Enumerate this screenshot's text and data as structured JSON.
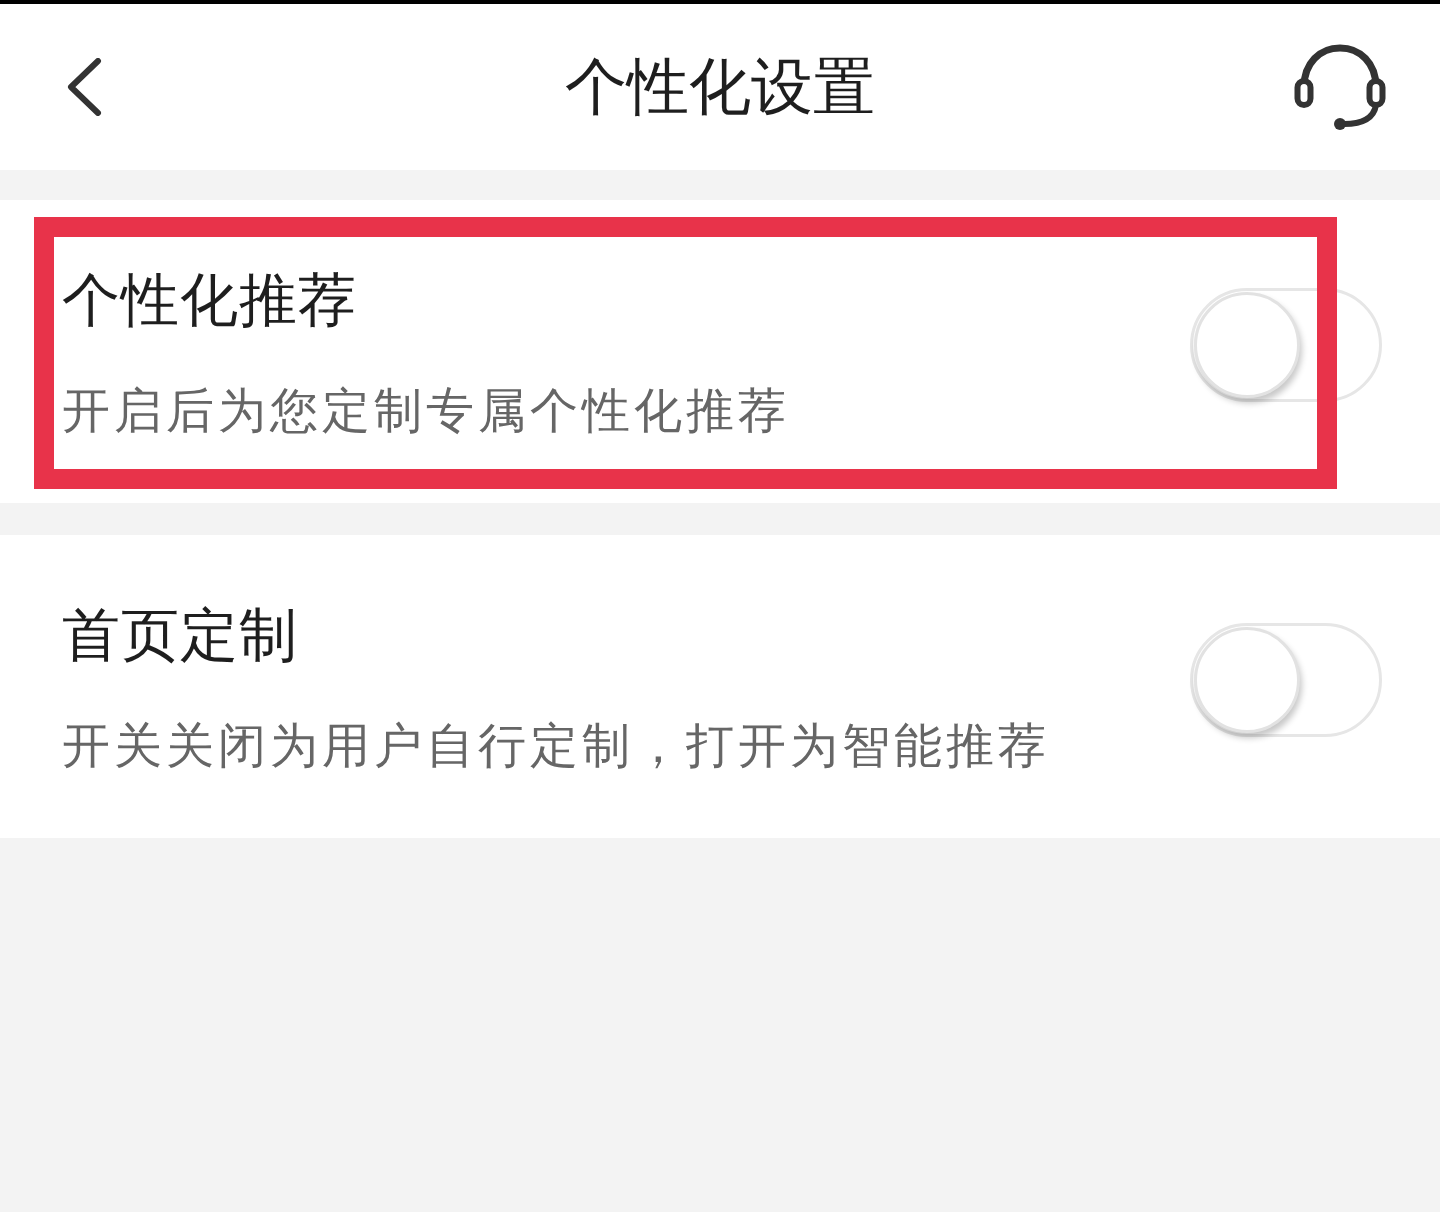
{
  "header": {
    "title": "个性化设置"
  },
  "settings": [
    {
      "title": "个性化推荐",
      "description": "开启后为您定制专属个性化推荐",
      "on": false,
      "highlighted": true
    },
    {
      "title": "首页定制",
      "description": "开关关闭为用户自行定制，打开为智能推荐",
      "on": false,
      "highlighted": false
    }
  ]
}
